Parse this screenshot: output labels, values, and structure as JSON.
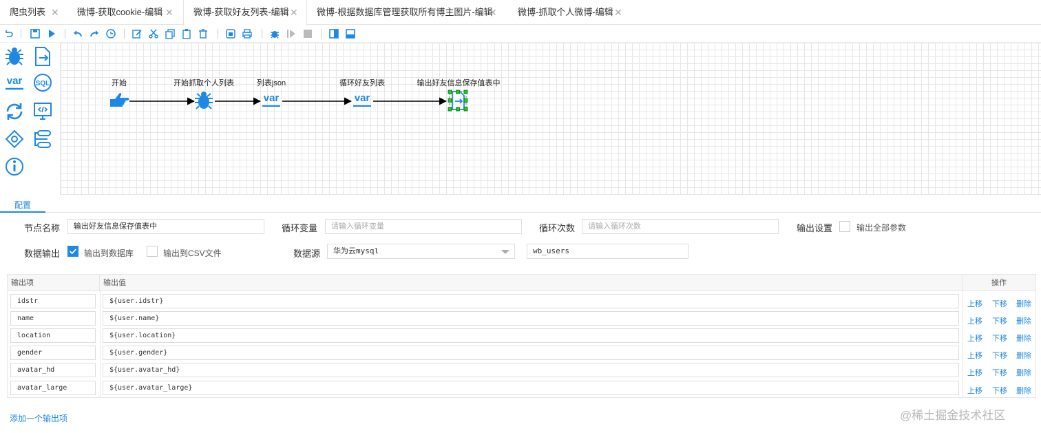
{
  "tabs": [
    {
      "label": "爬虫列表"
    },
    {
      "label": "微博-获取cookie-编辑"
    },
    {
      "label": "微博-获取好友列表-编辑"
    },
    {
      "label": "微博-根据数据库管理获取所有博主图片-编辑"
    },
    {
      "label": "微博-抓取个人微博-编辑"
    }
  ],
  "tab_close": "✕",
  "palette": {
    "var_label": "var",
    "sql_label": "SQL"
  },
  "flow": {
    "nodes": [
      {
        "label": "开始"
      },
      {
        "label": "开始抓取个人列表"
      },
      {
        "label": "列表json"
      },
      {
        "label": "循环好友列表"
      },
      {
        "label": "输出好友信息保存值表中"
      }
    ],
    "var_text": "var"
  },
  "config": {
    "tab_label": "配置",
    "node_name_label": "节点名称",
    "node_name_value": "输出好友信息保存值表中",
    "loop_var_label": "循环变量",
    "loop_var_placeholder": "请输入循环变量",
    "loop_count_label": "循环次数",
    "loop_count_placeholder": "请输入循环次数",
    "output_settings_label": "输出设置",
    "output_all_label": "输出全部参数",
    "data_output_label": "数据输出",
    "to_db_label": "输出到数据库",
    "to_csv_label": "输出到CSV文件",
    "datasource_label": "数据源",
    "datasource_value": "华为云mysql",
    "table_name_value": "wb_users"
  },
  "table": {
    "headers": {
      "key": "输出项",
      "value": "输出值",
      "ops": "操作"
    },
    "rows": [
      {
        "key": "idstr",
        "value": "${user.idstr}"
      },
      {
        "key": "name",
        "value": "${user.name}"
      },
      {
        "key": "location",
        "value": "${user.location}"
      },
      {
        "key": "gender",
        "value": "${user.gender}"
      },
      {
        "key": "avatar_hd",
        "value": "${user.avatar_hd}"
      },
      {
        "key": "avatar_large",
        "value": "${user.avatar_large}"
      }
    ],
    "op_up": "上移",
    "op_down": "下移",
    "op_delete": "删除",
    "add_label": "添加一个输出项"
  },
  "watermark": "@稀土掘金技术社区",
  "colors": {
    "accent": "#1e88e5",
    "selection": "#22aa22"
  }
}
